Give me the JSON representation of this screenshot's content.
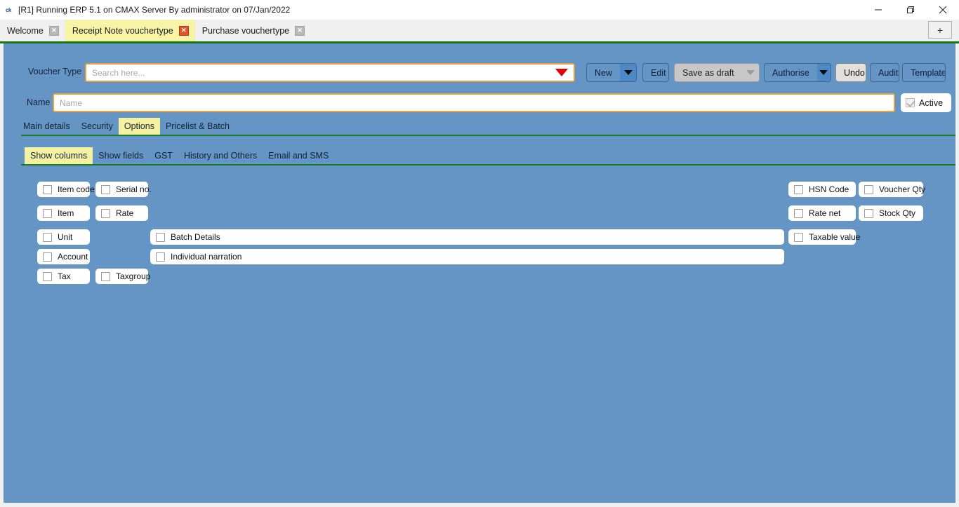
{
  "window": {
    "title": "[R1] Running ERP 5.1 on CMAX Server By administrator on 07/Jan/2022",
    "logo_text": "ck",
    "controls": {
      "minimize": "minimize-icon",
      "restore": "restore-icon",
      "close": "close-icon"
    }
  },
  "tabstrip": {
    "tabs": [
      {
        "label": "Welcome",
        "active": false
      },
      {
        "label": "Receipt Note vouchertype",
        "active": true
      },
      {
        "label": "Purchase vouchertype",
        "active": false
      }
    ],
    "new_tab_label": "+"
  },
  "form": {
    "voucher_type_label": "Voucher Type",
    "search_placeholder": "Search here...",
    "name_label": "Name",
    "name_placeholder": "Name",
    "name_value": "",
    "active_label": "Active",
    "active_checked": true
  },
  "toolbar": {
    "buttons": [
      {
        "label": "New",
        "has_split": true,
        "state": "normal"
      },
      {
        "label": "Edit",
        "has_split": false,
        "state": "normal"
      },
      {
        "label": "Save as draft",
        "has_split": true,
        "state": "disabled"
      },
      {
        "label": "Authorise",
        "has_split": true,
        "state": "normal"
      },
      {
        "label": "Undo",
        "has_split": false,
        "state": "highlight"
      },
      {
        "label": "Audit",
        "has_split": false,
        "state": "normal"
      },
      {
        "label": "Template",
        "has_split": false,
        "state": "normal"
      }
    ]
  },
  "nav": {
    "primary_tabs": [
      {
        "label": "Main details",
        "active": false
      },
      {
        "label": "Security",
        "active": false
      },
      {
        "label": "Options",
        "active": true
      },
      {
        "label": "Pricelist & Batch",
        "active": false
      }
    ],
    "secondary_tabs": [
      {
        "label": "Show columns",
        "active": true
      },
      {
        "label": "Show fields",
        "active": false
      },
      {
        "label": "GST",
        "active": false
      },
      {
        "label": "History and Others",
        "active": false
      },
      {
        "label": "Email and SMS",
        "active": false
      }
    ]
  },
  "show_columns": {
    "left_column": [
      {
        "label": "Item code",
        "checked": false
      },
      {
        "label": "Item",
        "checked": false
      },
      {
        "label": "Unit",
        "checked": false
      },
      {
        "label": "Account",
        "checked": false
      },
      {
        "label": "Tax",
        "checked": false
      }
    ],
    "second_column": [
      {
        "label": "Serial no.",
        "checked": false
      },
      {
        "label": "Rate",
        "checked": false
      },
      {
        "label": "Taxgroup",
        "checked": false
      }
    ],
    "wide_fields": [
      {
        "label": "Batch Details",
        "checked": false
      },
      {
        "label": "Individual narration",
        "checked": false
      }
    ],
    "right_column_1": [
      {
        "label": "HSN  Code",
        "checked": false
      },
      {
        "label": "Rate net",
        "checked": false
      },
      {
        "label": "Taxable value",
        "checked": false
      }
    ],
    "right_column_2": [
      {
        "label": "Voucher Qty",
        "checked": false
      },
      {
        "label": "Stock Qty",
        "checked": false
      }
    ]
  },
  "colors": {
    "panel_blue": "#6495c4",
    "accent_green": "#127a15",
    "active_tab_yellow": "#f4f2a0",
    "field_border_gold": "#e8a33d",
    "caret_red": "#e00000"
  }
}
